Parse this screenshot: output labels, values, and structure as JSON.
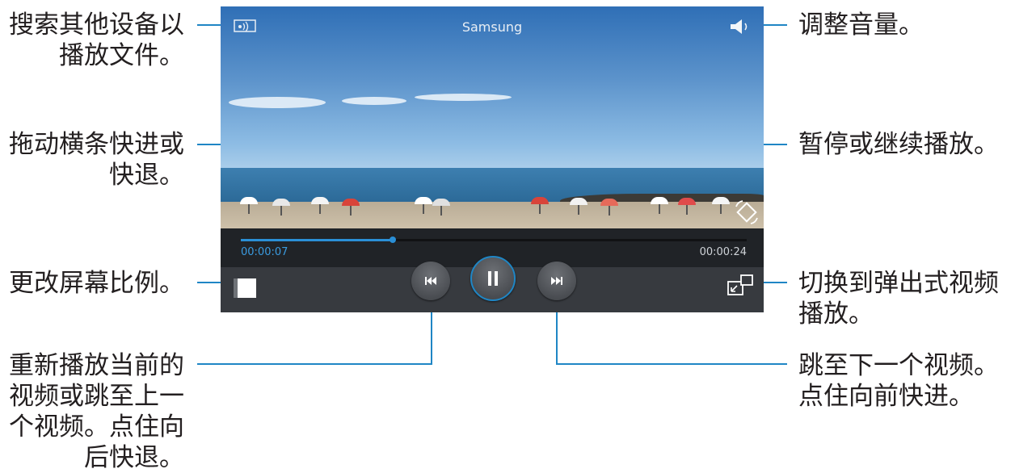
{
  "player": {
    "title": "Samsung",
    "time_elapsed": "00:00:07",
    "time_total": "00:00:24",
    "progress": 0.3,
    "icons": {
      "allshare": "allshare-icon",
      "volume": "volume-icon",
      "rotate": "rotate-icon",
      "ratio": "screen-ratio-icon",
      "prev": "rewind-icon",
      "pause": "pause-icon",
      "next": "fast-forward-icon",
      "popup": "popup-player-icon"
    },
    "colors": {
      "accent": "#1f86c5",
      "controls_bg": "#373a3f"
    }
  },
  "callouts": {
    "allshare": "搜索其他设备以\n播放文件。",
    "seek": "拖动横条快进或\n快退。",
    "ratio": "更改屏幕比例。",
    "prev": "重新播放当前的\n视频或跳至上一\n个视频。点住向\n后快退。",
    "volume": "调整音量。",
    "pause": "暂停或继续播放。",
    "popup": "切换到弹出式视频\n播放。",
    "next": "跳至下一个视频。\n点住向前快进。"
  }
}
